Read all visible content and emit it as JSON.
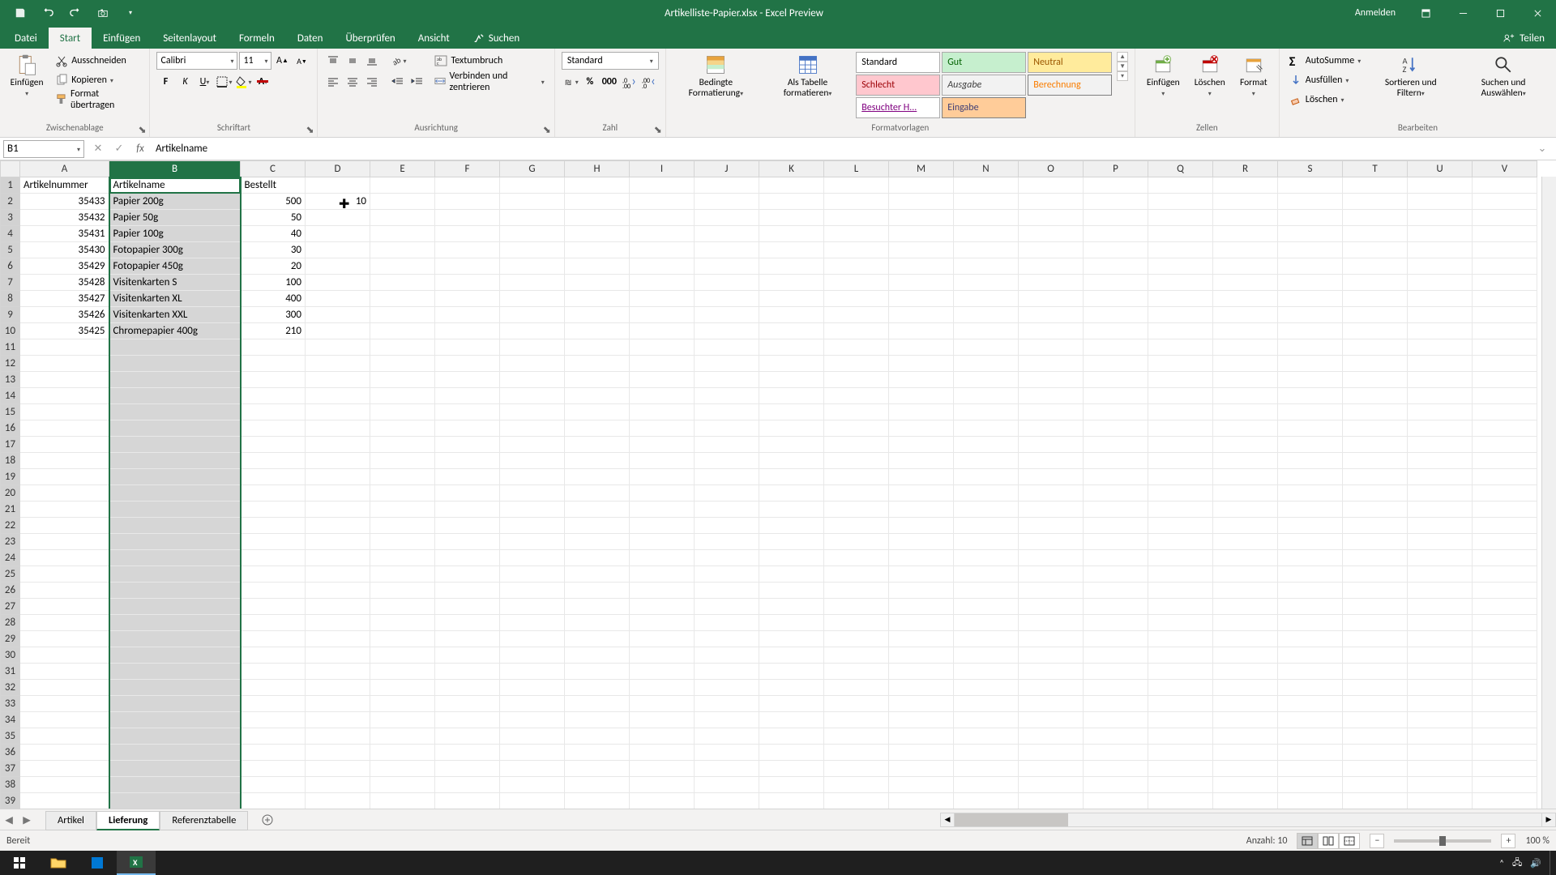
{
  "titlebar": {
    "filename": "Artikelliste-Papier.xlsx",
    "app": "Excel Preview",
    "login": "Anmelden"
  },
  "tabs": {
    "file": "Datei",
    "start": "Start",
    "einfuegen": "Einfügen",
    "seitenlayout": "Seitenlayout",
    "formeln": "Formeln",
    "daten": "Daten",
    "ueberpruefen": "Überprüfen",
    "ansicht": "Ansicht",
    "suchen": "Suchen",
    "teilen": "Teilen"
  },
  "ribbon": {
    "clipboard": {
      "einfuegen": "Einfügen",
      "ausschneiden": "Ausschneiden",
      "kopieren": "Kopieren",
      "format_uebertragen": "Format übertragen",
      "label": "Zwischenablage"
    },
    "font": {
      "name": "Calibri",
      "size": "11",
      "label": "Schriftart"
    },
    "alignment": {
      "textumbruch": "Textumbruch",
      "verbinden": "Verbinden und zentrieren",
      "label": "Ausrichtung"
    },
    "number": {
      "format": "Standard",
      "label": "Zahl"
    },
    "styles": {
      "bedingte": "Bedingte Formatierung",
      "als_tabelle": "Als Tabelle formatieren",
      "standard": "Standard",
      "gut": "Gut",
      "neutral": "Neutral",
      "schlecht": "Schlecht",
      "ausgabe": "Ausgabe",
      "berechnung": "Berechnung",
      "besuchter": "Besuchter H...",
      "eingabe": "Eingabe",
      "label": "Formatvorlagen"
    },
    "cells": {
      "einfuegen": "Einfügen",
      "loeschen": "Löschen",
      "format": "Format",
      "label": "Zellen"
    },
    "editing": {
      "autosumme": "AutoSumme",
      "ausfuellen": "Ausfüllen",
      "loeschen": "Löschen",
      "sortieren": "Sortieren und Filtern",
      "suchen": "Suchen und Auswählen",
      "label": "Bearbeiten"
    }
  },
  "formula_bar": {
    "name_box": "B1",
    "formula": "Artikelname"
  },
  "columns": {
    "A": "A",
    "B": "B",
    "C": "C",
    "D": "D",
    "E": "E",
    "F": "F",
    "G": "G",
    "H": "H",
    "I": "I",
    "J": "J",
    "K": "K",
    "L": "L",
    "M": "M",
    "N": "N",
    "O": "O",
    "P": "P",
    "Q": "Q",
    "R": "R",
    "S": "S",
    "T": "T",
    "U": "U",
    "V": "V"
  },
  "headers": {
    "A": "Artikelnummer",
    "B": "Artikelname",
    "C": "Bestellt"
  },
  "rows": [
    {
      "A": "35433",
      "B": "Papier 200g",
      "C": "500",
      "D": "10"
    },
    {
      "A": "35432",
      "B": "Papier 50g",
      "C": "50"
    },
    {
      "A": "35431",
      "B": "Papier 100g",
      "C": "40"
    },
    {
      "A": "35430",
      "B": "Fotopapier 300g",
      "C": "30"
    },
    {
      "A": "35429",
      "B": "Fotopapier 450g",
      "C": "20"
    },
    {
      "A": "35428",
      "B": "Visitenkarten S",
      "C": "100"
    },
    {
      "A": "35427",
      "B": "Visitenkarten XL",
      "C": "400"
    },
    {
      "A": "35426",
      "B": "Visitenkarten XXL",
      "C": "300"
    },
    {
      "A": "35425",
      "B": "Chromepapier 400g",
      "C": "210"
    }
  ],
  "sheets": {
    "artikel": "Artikel",
    "lieferung": "Lieferung",
    "referenz": "Referenztabelle"
  },
  "statusbar": {
    "ready": "Bereit",
    "count_label": "Anzahl:",
    "count": "10",
    "zoom": "100 %"
  }
}
